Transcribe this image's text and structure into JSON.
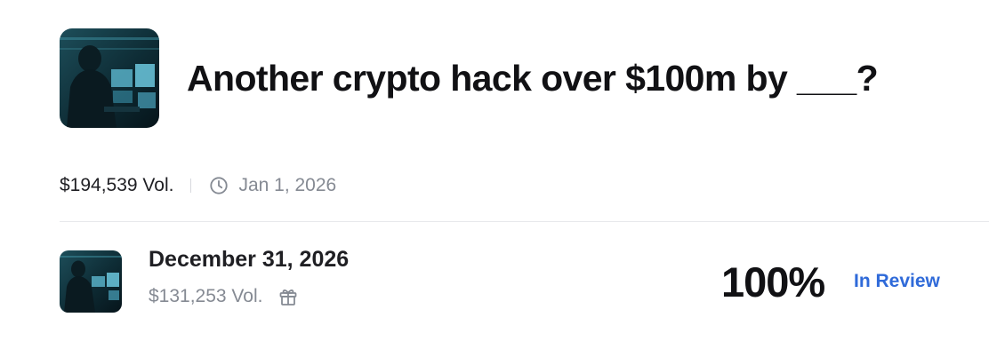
{
  "market": {
    "title": "Another crypto hack over $100m by ___?",
    "image": "hacker-at-computers-image",
    "volume": "$194,539 Vol.",
    "end_date": "Jan 1, 2026"
  },
  "outcomes": [
    {
      "name": "December 31, 2026",
      "image": "hacker-at-computers-image",
      "volume": "$131,253 Vol.",
      "percent": "100%",
      "status": "In Review"
    }
  ],
  "icons": {
    "clock": "clock-icon",
    "gift": "gift-icon"
  },
  "colors": {
    "status_blue": "#2f6ad9",
    "muted_text": "#858a93",
    "title_text": "#111114"
  }
}
